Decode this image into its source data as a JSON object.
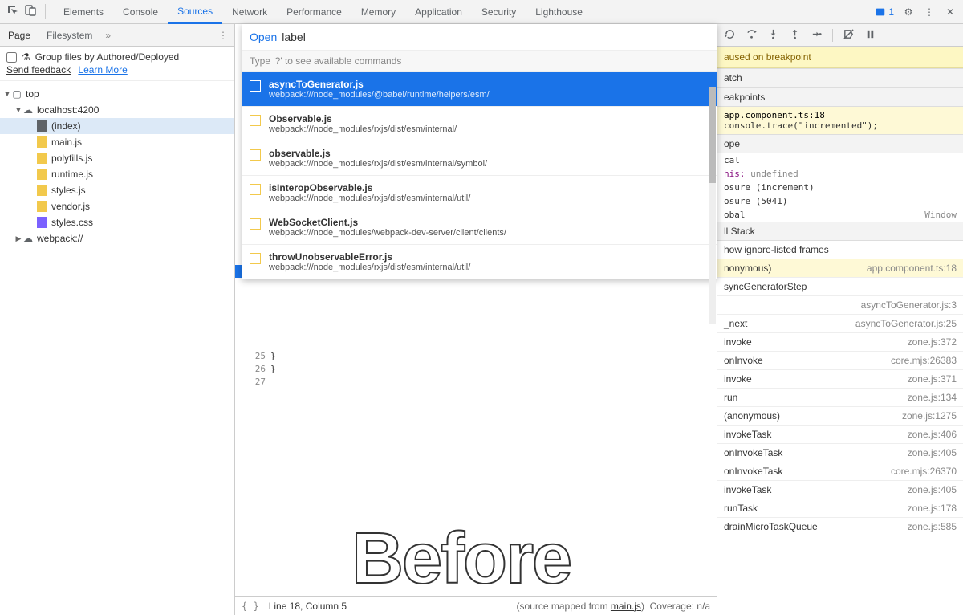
{
  "topTabs": {
    "elements": "Elements",
    "console": "Console",
    "sources": "Sources",
    "network": "Network",
    "performance": "Performance",
    "memory": "Memory",
    "application": "Application",
    "security": "Security",
    "lighthouse": "Lighthouse"
  },
  "issueCount": "1",
  "sideTabs": {
    "page": "Page",
    "filesystem": "Filesystem",
    "more": "»"
  },
  "groupLabel": "Group files by Authored/Deployed",
  "feedback": "Send feedback",
  "learn": "Learn More",
  "tree": {
    "top": "top",
    "host": "localhost:4200",
    "index": "(index)",
    "main": "main.js",
    "poly": "polyfills.js",
    "runtime": "runtime.js",
    "stylesjs": "styles.js",
    "vendor": "vendor.js",
    "stylescss": "styles.css",
    "webpack": "webpack://"
  },
  "open": {
    "prefix": "Open",
    "query": "label",
    "hint": "Type '?' to see available commands",
    "items": [
      {
        "name": "asyncToGenerator.js",
        "path": "webpack:///node_modules/@babel/runtime/helpers/esm/"
      },
      {
        "name": "Observable.js",
        "path": "webpack:///node_modules/rxjs/dist/esm/internal/"
      },
      {
        "name": "observable.js",
        "path": "webpack:///node_modules/rxjs/dist/esm/internal/symbol/"
      },
      {
        "name": "isInteropObservable.js",
        "path": "webpack:///node_modules/rxjs/dist/esm/internal/util/"
      },
      {
        "name": "WebSocketClient.js",
        "path": "webpack:///node_modules/webpack-dev-server/client/clients/"
      },
      {
        "name": "throwUnobservableError.js",
        "path": "webpack:///node_modules/rxjs/dist/esm/internal/util/"
      }
    ]
  },
  "code": {
    "lines": [
      "25",
      "26",
      "27"
    ],
    "body": [
      "  }",
      "}",
      ""
    ]
  },
  "status": {
    "pos": "Line 18, Column 5",
    "map": "(source mapped from ",
    "mapfile": "main.js",
    "map2": ")",
    "cov": "Coverage: n/a"
  },
  "watermark": "Before",
  "right": {
    "paused": "aused on breakpoint",
    "watch": "atch",
    "breakpoints": "eakpoints",
    "bp1": "app.component.ts:18",
    "bp2": "console.trace(\"incremented\");",
    "scope": "ope",
    "local": "cal",
    "thisLine": "his: ",
    "undef": "undefined",
    "clos1": "osure (increment)",
    "clos2": "osure (5041)",
    "global": "obal",
    "window": "Window",
    "callstack": "ll Stack",
    "showIgnore": "how ignore-listed frames",
    "stack": [
      {
        "fn": "nonymous)",
        "loc": "app.component.ts:18"
      },
      {
        "fn": "syncGeneratorStep",
        "loc": ""
      },
      {
        "fn": "",
        "loc": "asyncToGenerator.js:3"
      },
      {
        "fn": "_next",
        "loc": "asyncToGenerator.js:25"
      },
      {
        "fn": "invoke",
        "loc": "zone.js:372"
      },
      {
        "fn": "onInvoke",
        "loc": "core.mjs:26383"
      },
      {
        "fn": "invoke",
        "loc": "zone.js:371"
      },
      {
        "fn": "run",
        "loc": "zone.js:134"
      },
      {
        "fn": "(anonymous)",
        "loc": "zone.js:1275"
      },
      {
        "fn": "invokeTask",
        "loc": "zone.js:406"
      },
      {
        "fn": "onInvokeTask",
        "loc": "zone.js:405"
      },
      {
        "fn": "onInvokeTask",
        "loc": "core.mjs:26370"
      },
      {
        "fn": "invokeTask",
        "loc": "zone.js:405"
      },
      {
        "fn": "runTask",
        "loc": "zone.js:178"
      },
      {
        "fn": "drainMicroTaskQueue",
        "loc": "zone.js:585"
      }
    ]
  }
}
